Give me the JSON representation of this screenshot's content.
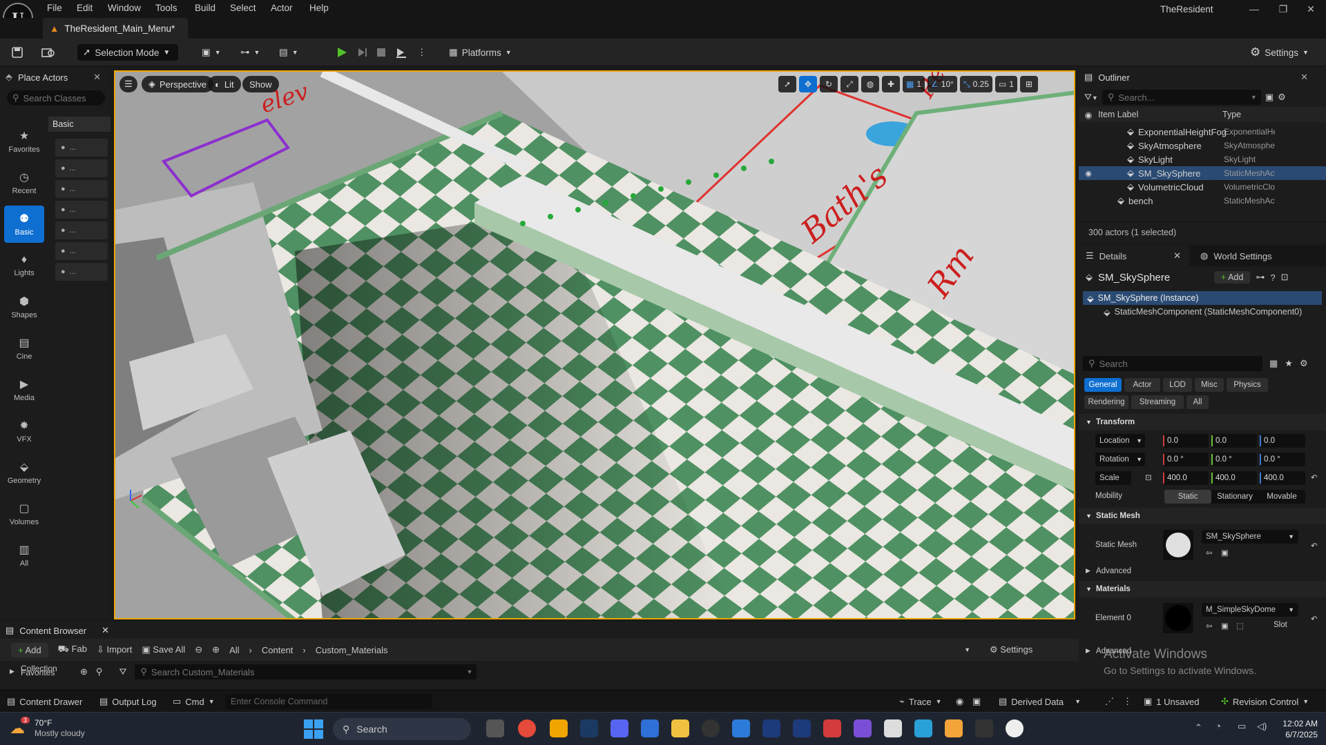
{
  "menubar": {
    "items": [
      "File",
      "Edit",
      "Window",
      "Tools",
      "Build",
      "Select",
      "Actor",
      "Help"
    ],
    "app_name": "TheResident"
  },
  "tab": {
    "level_name": "TheResident_Main_Menu*"
  },
  "toolbar": {
    "selection_mode": "Selection Mode",
    "platforms": "Platforms",
    "settings": "Settings"
  },
  "place_actors": {
    "title": "Place Actors",
    "search_placeholder": "Search Classes",
    "section_title": "Basic",
    "categories": [
      {
        "label": "Favorites",
        "icon": "star-icon"
      },
      {
        "label": "Recent",
        "icon": "clock-icon"
      },
      {
        "label": "Basic",
        "icon": "basic-actor-icon",
        "selected": true
      },
      {
        "label": "Lights",
        "icon": "light-bulb-icon"
      },
      {
        "label": "Shapes",
        "icon": "cube-icon"
      },
      {
        "label": "Cine",
        "icon": "clapper-icon"
      },
      {
        "label": "Media",
        "icon": "media-play-icon"
      },
      {
        "label": "VFX",
        "icon": "vfx-sparkle-icon"
      },
      {
        "label": "Geometry",
        "icon": "geometry-icon"
      },
      {
        "label": "Volumes",
        "icon": "volume-icon"
      },
      {
        "label": "All",
        "icon": "all-actors-icon"
      }
    ],
    "actor_items": [
      "...",
      "...",
      "...",
      "...",
      "...",
      "...",
      "..."
    ]
  },
  "viewport": {
    "menu_icon": "hamburger-icon",
    "view_mode": "Perspective",
    "lighting": "Lit",
    "show": "Show",
    "grid_snap": "1",
    "rotation_snap": "10°",
    "scale_snap": "0.25",
    "camera_speed": "1",
    "scene_text": {
      "left": "elev",
      "right_top": "Re",
      "right_mid": "Bath's",
      "right_low": "Rm"
    }
  },
  "outliner": {
    "title": "Outliner",
    "search_placeholder": "Search...",
    "col_label": "Item Label",
    "col_type": "Type",
    "rows": [
      {
        "label": "ExponentialHeightFog",
        "type": "ExponentialHe",
        "indent": 1,
        "selected": false
      },
      {
        "label": "SkyAtmosphere",
        "type": "SkyAtmospher",
        "indent": 1,
        "selected": false
      },
      {
        "label": "SkyLight",
        "type": "SkyLight",
        "indent": 1,
        "selected": false
      },
      {
        "label": "SM_SkySphere",
        "type": "StaticMeshAct",
        "indent": 1,
        "selected": true
      },
      {
        "label": "VolumetricCloud",
        "type": "VolumetricClou",
        "indent": 1,
        "selected": false
      },
      {
        "label": "bench",
        "type": "StaticMeshAct",
        "indent": 0,
        "selected": false
      }
    ],
    "footer": "300 actors (1 selected)"
  },
  "details": {
    "tab_details": "Details",
    "tab_world": "World Settings",
    "actor_name": "SM_SkySphere",
    "add_label": "Add",
    "components": [
      "SM_SkySphere (Instance)",
      "StaticMeshComponent (StaticMeshComponent0)"
    ],
    "search_placeholder": "Search",
    "filters_row1": [
      "General",
      "Actor",
      "LOD",
      "Misc",
      "Physics"
    ],
    "filters_row2": [
      "Rendering",
      "Streaming",
      "All"
    ],
    "transform": {
      "title": "Transform",
      "location_label": "Location",
      "location": [
        "0.0",
        "0.0",
        "0.0"
      ],
      "rotation_label": "Rotation",
      "rotation": [
        "0.0 °",
        "0.0 °",
        "0.0 °"
      ],
      "scale_label": "Scale",
      "scale": [
        "400.0",
        "400.0",
        "400.0"
      ],
      "mobility_label": "Mobility",
      "mobility_options": [
        "Static",
        "Stationary",
        "Movable"
      ]
    },
    "static_mesh": {
      "title": "Static Mesh",
      "label": "Static Mesh",
      "value": "SM_SkySphere"
    },
    "advanced": "Advanced",
    "materials": {
      "title": "Materials",
      "element_label": "Element 0",
      "value": "M_SimpleSkyDome",
      "slot": "Slot"
    },
    "advanced2": "Advanced"
  },
  "activate_windows": {
    "title": "Activate Windows",
    "subtitle": "Go to Settings to activate Windows."
  },
  "content_browser": {
    "title": "Content Browser",
    "add": "Add",
    "fab": "Fab",
    "import": "Import",
    "save_all": "Save All",
    "breadcrumb": [
      "All",
      "Content",
      "Custom_Materials"
    ],
    "settings": "Settings",
    "favorites": "Favorites",
    "collection": "Collection",
    "search_placeholder": "Search Custom_Materials"
  },
  "statusbar": {
    "content_drawer": "Content Drawer",
    "output_log": "Output Log",
    "cmd": "Cmd",
    "console_placeholder": "Enter Console Command",
    "trace": "Trace",
    "derived_data": "Derived Data",
    "unsaved": "1 Unsaved",
    "revision_control": "Revision Control"
  },
  "taskbar": {
    "weather_temp": "70°F",
    "weather_desc": "Mostly cloudy",
    "weather_badge": "3",
    "search": "Search",
    "time": "12:02 AM",
    "date": "6/7/2025"
  },
  "colors": {
    "accent": "#0e6fd1",
    "viewport_border": "#f0a500",
    "play_green": "#53c22b",
    "selected_row": "#2a4a73"
  }
}
